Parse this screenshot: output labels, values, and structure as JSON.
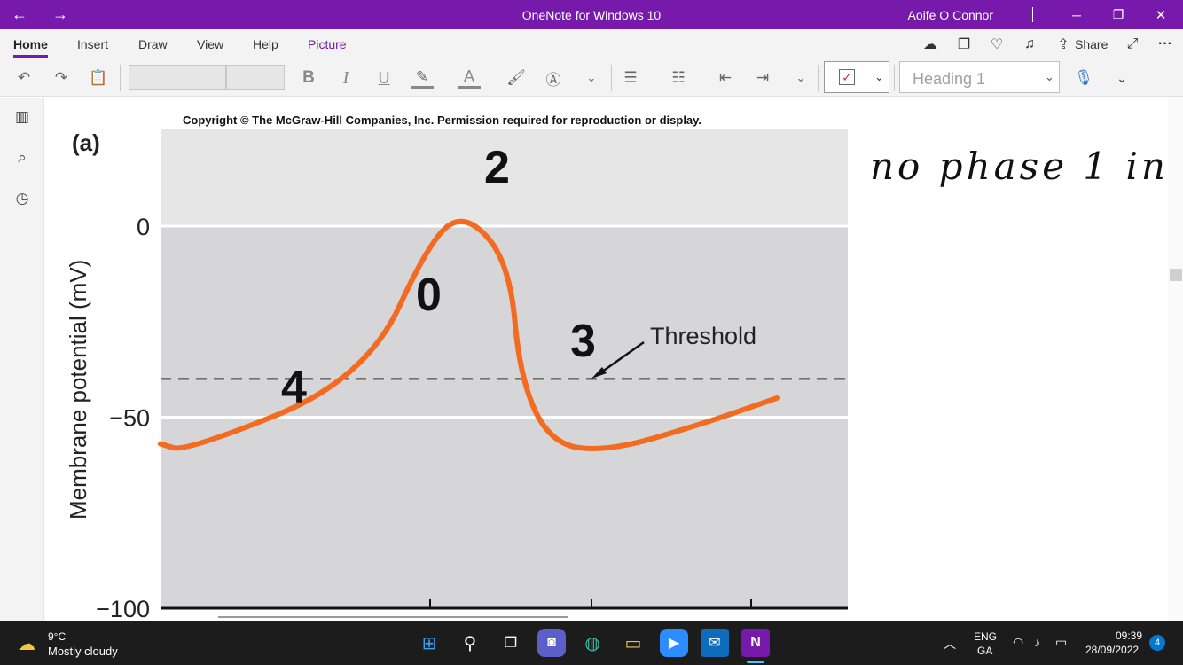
{
  "window": {
    "title": "OneNote for Windows 10",
    "user": "Aoife O Connor",
    "controls": {
      "minimize": "─",
      "restore": "❐",
      "close": "✕"
    }
  },
  "nav_arrows": {
    "back": "←",
    "forward": "→"
  },
  "menu": {
    "tabs": [
      "Home",
      "Insert",
      "Draw",
      "View",
      "Help",
      "Picture"
    ],
    "share": "Share",
    "more": "···"
  },
  "ribbon": {
    "bold": "B",
    "italic": "I",
    "underline": "U",
    "font_color": "A",
    "style_placeholder": "Heading 1"
  },
  "figure": {
    "copyright": "Copyright © The McGraw-Hill Companies, Inc. Permission required for reproduction or display.",
    "panel_label": "(a)",
    "y_axis_label": "Membrane potential (mV)",
    "y_ticks": [
      "0",
      "−50",
      "−100"
    ],
    "phase_labels": [
      "2",
      "0",
      "3",
      "4"
    ],
    "threshold_label": "Threshold",
    "accent_color": "#f26b21"
  },
  "chart_data": {
    "type": "line",
    "title": "",
    "xlabel": "",
    "ylabel": "Membrane potential (mV)",
    "ylim": [
      -100,
      0
    ],
    "yticks": [
      0,
      -50,
      -100
    ],
    "threshold_mV": -40,
    "series": [
      {
        "x": [
          0,
          5,
          40,
          53,
          60,
          68,
          70,
          76,
          87,
          105,
          120
        ],
        "y": [
          -57,
          -59,
          -40,
          -2,
          3,
          -10,
          -40,
          -57,
          -59,
          -52,
          -45
        ]
      }
    ],
    "grid": true
  },
  "handwriting": "no phase 1 in",
  "taskbar": {
    "weather_temp": "9°C",
    "weather_desc": "Mostly cloudy",
    "lang_top": "ENG",
    "lang_bottom": "GA",
    "time": "09:39",
    "date": "28/09/2022",
    "notifications": "4"
  }
}
